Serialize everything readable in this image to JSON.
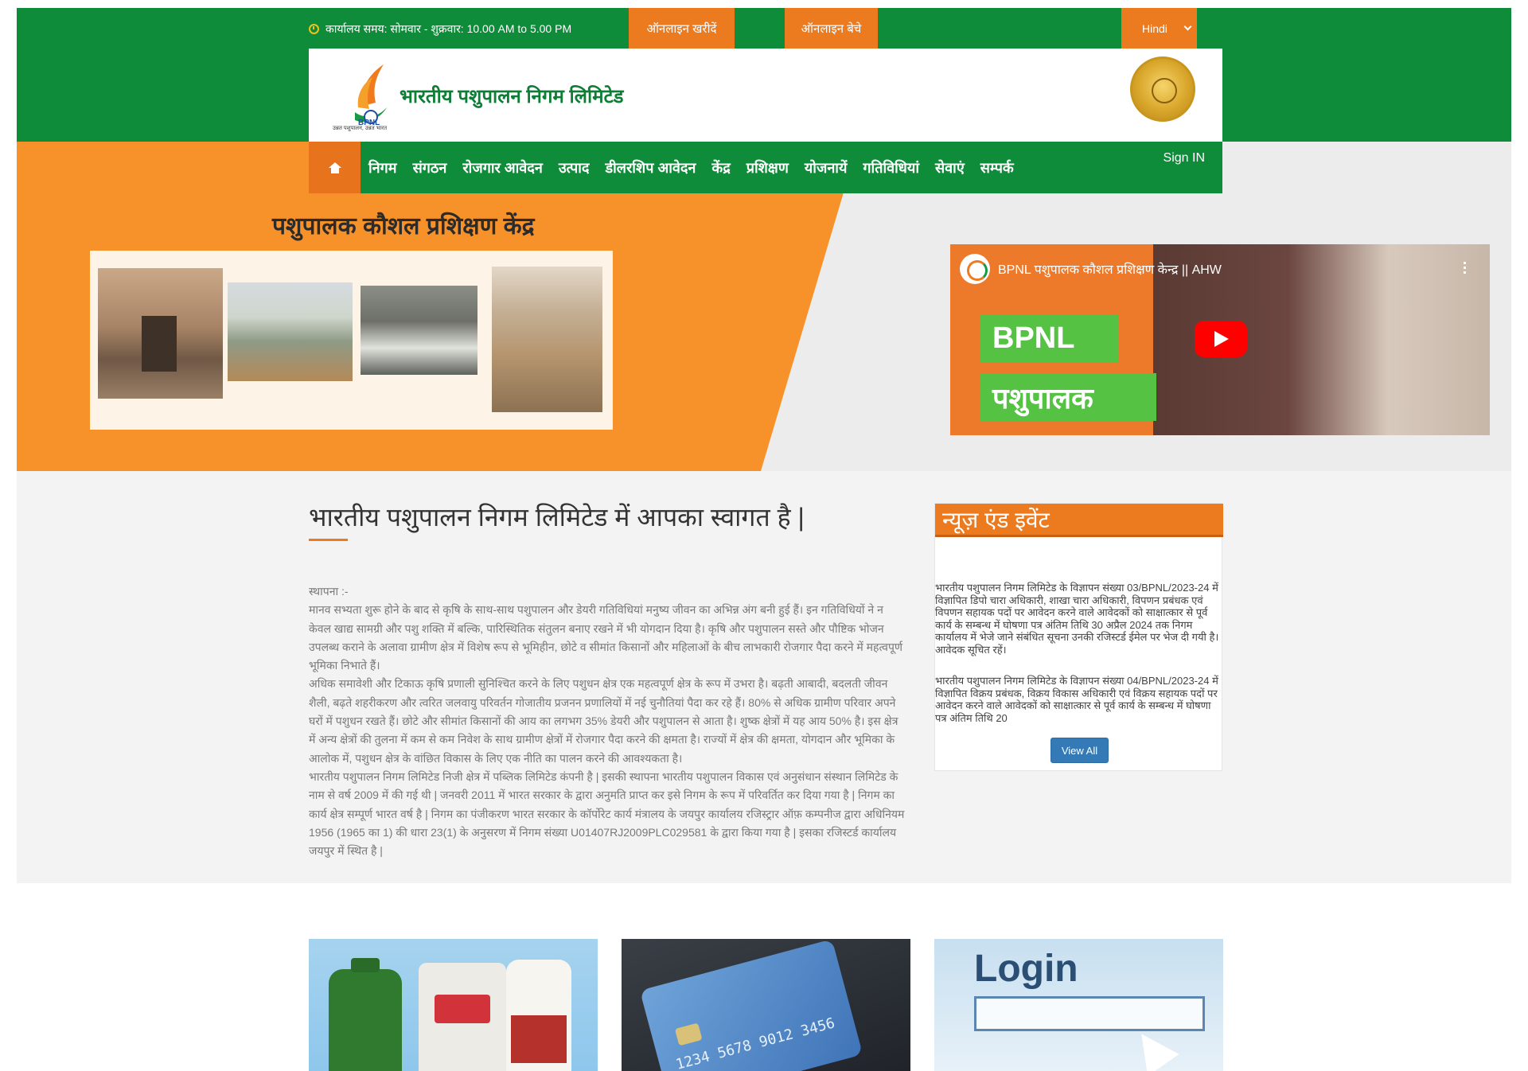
{
  "topbar": {
    "office_time": "कार्यालय समय: सोमवार - शुक्रवार: 10.00 AM to 5.00 PM",
    "buy_online": "ऑनलाइन खरीदें",
    "sell_online": "ऑनलाइन बेचे",
    "language": "Hindi"
  },
  "header": {
    "org_name": "भारतीय पशुपालन निगम लिमिटेड",
    "logo_abbrev": "BPNL",
    "logo_tagline": "उन्नत पशुपालन, उन्नत भारत"
  },
  "nav": {
    "items": [
      "निगम",
      "संगठन",
      "रोजगार आवेदन",
      "उत्पाद",
      "डीलरशिप आवेदन",
      "केंद्र",
      "प्रशिक्षण",
      "योजनायें",
      "गतिविधियां",
      "सेवाएं",
      "सम्पर्क"
    ],
    "sign_in": "Sign IN"
  },
  "banner": {
    "title": "पशुपालक कौशल प्रशिक्षण केंद्र"
  },
  "video": {
    "title": "BPNL पशुपालक कौशल प्रशिक्षण केन्द्र || AHW",
    "badge1": "BPNL",
    "badge2": "पशुपालक"
  },
  "welcome": {
    "title": "भारतीय पशुपालन निगम लिमिटेड में आपका स्वागत है |",
    "heading": "स्थापना :-",
    "paragraphs": [
      "मानव सभ्यता शुरू होने के बाद से कृषि के साथ-साथ पशुपालन और डेयरी गतिविधियां मनुष्य जीवन का अभिन्न अंग बनी हुई हैं। इन गतिविधियों ने न केवल खाद्य सामग्री और पशु शक्ति में बल्कि, पारिस्थितिक संतुलन बनाए रखने में भी योगदान दिया है। कृषि और पशुपालन सस्ते और पौष्टिक भोजन उपलब्ध कराने के अलावा ग्रामीण क्षेत्र में विशेष रूप से भूमिहीन, छोटे व सीमांत किसानों और महिलाओं के बीच लाभकारी रोजगार पैदा करने में महत्वपूर्ण भूमिका निभाते हैं।",
      "अधिक समावेशी और टिकाऊ कृषि प्रणाली सुनिश्चित करने के लिए पशुधन क्षेत्र एक महत्वपूर्ण क्षेत्र के रूप में उभरा है। बढ़ती आबादी, बदलती जीवन शैली, बढ़ते शहरीकरण और त्वरित जलवायु परिवर्तन गोजातीय प्रजनन प्रणालियों में नई चुनौतियां पैदा कर रहे हैं। 80% से अधिक ग्रामीण परिवार अपने घरों में पशुधन रखते हैं। छोटे और सीमांत किसानों की  आय का लगभग 35% डेयरी और पशुपालन से आता है। शुष्क क्षेत्रों में यह आय 50% है। इस क्षेत्र में अन्य क्षेत्रों की तुलना में कम से कम निवेश के साथ ग्रामीण क्षेत्रों में रोजगार पैदा करने की क्षमता है। राज्यों में क्षेत्र की क्षमता, योगदान और भूमिका के आलोक में, पशुधन क्षेत्र के वांछित विकास के लिए एक नीति का पालन करने की आवश्यकता है।",
      "भारतीय पशुपालन निगम लिमिटेड निजी क्षेत्र में पब्लिक लिमिटेड कंपनी है | इसकी स्थापना भारतीय पशुपालन विकास एवं अनुसंधान संस्थान लिमिटेड के नाम से वर्ष 2009 में की गई थी | जनवरी 2011 में भारत सरकार के द्वारा अनुमति प्राप्त कर इसे निगम के रूप में परिवर्तित कर दिया गया है | निगम का कार्य क्षेत्र सम्पूर्ण भारत वर्ष है | निगम का पंजीकरण भारत सरकार के कॉर्पोरेट कार्य मंत्रालय के जयपुर कार्यालय रजिस्ट्रार ऑफ़ कम्पनीज द्वारा अधिनियम 1956 (1965 का 1) की धारा 23(1) के अनुसरण में निगम संख्या U01407RJ2009PLC029581 के द्वारा किया गया है | इसका रजिस्टर्ड कार्यालय जयपुर में स्थित है |"
    ]
  },
  "news": {
    "title": "न्यूज़ एंड इवेंट",
    "items": [
      "भारतीय पशुपालन निगम लिमिटेड के विज्ञापन संख्या 03/BPNL/2023-24 में विज्ञापित डिपो चारा अधिकारी, शाखा चारा अधिकारी, विपणन प्रबंधक एवं विपणन सहायक पदों पर आवेदन करने वाले आवेदकों को साक्षात्कार से पूर्व कार्य के सम्बन्ध में घोषणा पत्र अंतिम तिथि 30 अप्रैल 2024 तक निगम कार्यालय में भेजे जाने संबंधित सूचना उनकी रजिस्टर्ड ईमेल पर भेज दी गयी है।आवेदक सूचित रहें।",
      "भारतीय पशुपालन निगम लिमिटेड के विज्ञापन संख्या 04/BPNL/2023-24 में विज्ञापित विक्रय प्रबंधक, विक्रय विकास अधिकारी एवं विक्रय सहायक पदों पर आवेदन करने वाले आवेदकों को साक्षात्कार से पूर्व कार्य के सम्बन्ध में घोषणा पत्र अंतिम तिथि 20"
    ],
    "view_all": "View All"
  },
  "tiles": {
    "login_text": "Login",
    "card_number": "1234 5678 9012 3456"
  },
  "colors": {
    "green": "#0e8c3a",
    "orange": "#ec7b20",
    "banner_orange": "#f7922a",
    "button_blue": "#337ab7"
  }
}
